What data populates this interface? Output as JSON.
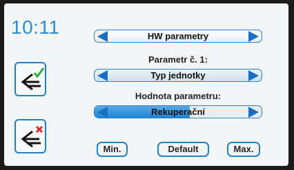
{
  "clock": {
    "time": "10:11"
  },
  "buttons": {
    "confirm_icon": "back-arrow-check-icon",
    "cancel_icon": "back-arrow-cross-icon",
    "min_label": "Min.",
    "default_label": "Default",
    "max_label": "Max."
  },
  "selectors": {
    "menu": {
      "value": "HW parametry"
    },
    "parameter": {
      "label": "Parametr č. 1:",
      "value": "Typ jednotky"
    },
    "param_value": {
      "label": "Hodnota parametru:",
      "value": "Rekuperační",
      "level_fraction": 0.57
    }
  },
  "colors": {
    "accent": "#1f7fc7",
    "clock": "#2a8fd8",
    "check": "#2eab3a",
    "cross": "#d42a2a"
  }
}
